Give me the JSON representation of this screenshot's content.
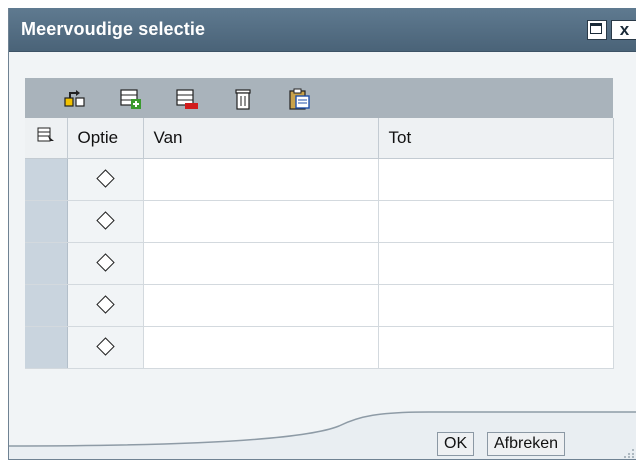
{
  "dialog": {
    "title": "Meervoudige selectie",
    "close_label": "x"
  },
  "toolbar": {
    "buttons": [
      {
        "icon": "expand-tree-icon"
      },
      {
        "icon": "insert-row-icon"
      },
      {
        "icon": "delete-row-icon"
      },
      {
        "icon": "trash-icon"
      },
      {
        "icon": "clipboard-icon"
      }
    ]
  },
  "grid": {
    "columns": [
      "Optie",
      "Van",
      "Tot"
    ],
    "rows": [
      {
        "van": "",
        "tot": ""
      },
      {
        "van": "",
        "tot": ""
      },
      {
        "van": "",
        "tot": ""
      },
      {
        "van": "",
        "tot": ""
      },
      {
        "van": "",
        "tot": ""
      }
    ]
  },
  "footer": {
    "ok_label": "OK",
    "cancel_label": "Afbreken"
  },
  "colors": {
    "titlebar": "#4f687d",
    "toolbar": "#a9b3bb",
    "row_selector": "#c9d4de",
    "background": "#f1f4f6"
  }
}
